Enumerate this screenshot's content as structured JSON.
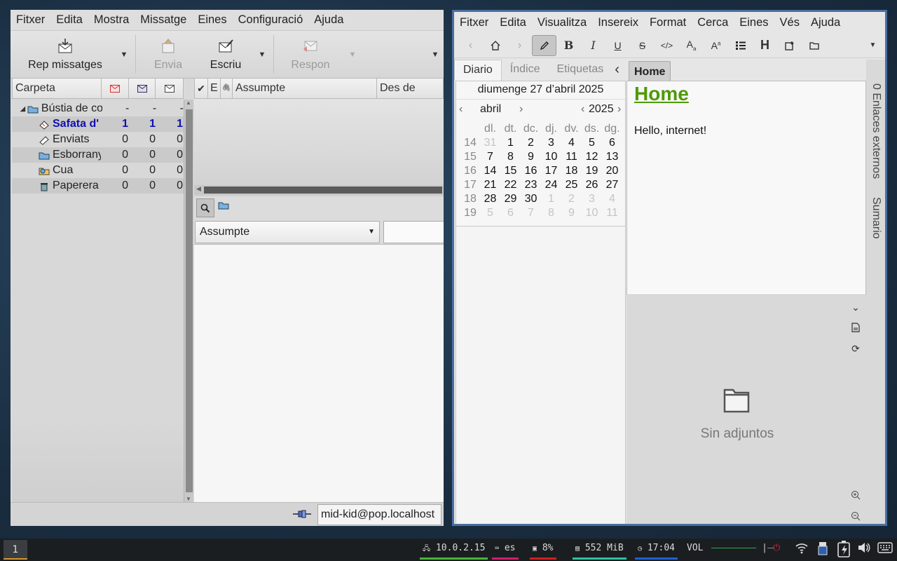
{
  "mail": {
    "menu": [
      "Fitxer",
      "Edita",
      "Mostra",
      "Missatge",
      "Eines",
      "Configuració",
      "Ajuda"
    ],
    "toolbar": {
      "receive": "Rep missatges",
      "send": "Envia",
      "compose": "Escriu",
      "reply": "Respon"
    },
    "folder_headers": {
      "folder": "Carpeta"
    },
    "folders": [
      {
        "name": "Bústia de co",
        "c1": "-",
        "c2": "-",
        "c3": "-"
      },
      {
        "name": "Safata d'",
        "c1": "1",
        "c2": "1",
        "c3": "1"
      },
      {
        "name": "Enviats",
        "c1": "0",
        "c2": "0",
        "c3": "0"
      },
      {
        "name": "Esborrany",
        "c1": "0",
        "c2": "0",
        "c3": "0"
      },
      {
        "name": "Cua",
        "c1": "0",
        "c2": "0",
        "c3": "0"
      },
      {
        "name": "Paperera",
        "c1": "0",
        "c2": "0",
        "c3": "0"
      }
    ],
    "list_headers": {
      "check": "✔",
      "e": "E",
      "attach": "🖇",
      "subject": "Assumpte",
      "from": "Des de"
    },
    "search": {
      "field": "Assumpte"
    },
    "status": {
      "account": "mid-kid@pop.localhost"
    }
  },
  "zim": {
    "menu": [
      "Fitxer",
      "Edita",
      "Visualitza",
      "Insereix",
      "Format",
      "Cerca",
      "Eines",
      "Vés",
      "Ajuda"
    ],
    "tabs": [
      "Diario",
      "Índice",
      "Etiquetas"
    ],
    "calendar": {
      "heading": "diumenge 27 d’abril 2025",
      "month": "abril",
      "year": "2025",
      "weekdays": [
        "dl.",
        "dt.",
        "dc.",
        "dj.",
        "dv.",
        "ds.",
        "dg."
      ],
      "weeks": [
        {
          "wk": "14",
          "days": [
            "31",
            "1",
            "2",
            "3",
            "4",
            "5",
            "6"
          ]
        },
        {
          "wk": "15",
          "days": [
            "7",
            "8",
            "9",
            "10",
            "11",
            "12",
            "13"
          ]
        },
        {
          "wk": "16",
          "days": [
            "14",
            "15",
            "16",
            "17",
            "18",
            "19",
            "20"
          ]
        },
        {
          "wk": "17",
          "days": [
            "21",
            "22",
            "23",
            "24",
            "25",
            "26",
            "27"
          ]
        },
        {
          "wk": "18",
          "days": [
            "28",
            "29",
            "30",
            "1",
            "2",
            "3",
            "4"
          ]
        },
        {
          "wk": "19",
          "days": [
            "5",
            "6",
            "7",
            "8",
            "9",
            "10",
            "11"
          ]
        }
      ]
    },
    "breadcrumb": "Home",
    "page": {
      "title": "Home",
      "body": "Hello, internet!",
      "title_color": "#4e9a06"
    },
    "attachments": {
      "empty": "Sin adjuntos"
    },
    "sidebar_tabs": [
      "0 Enlaces externos",
      "Sumario"
    ]
  },
  "taskbar": {
    "workspace": "1",
    "ip": "10.0.2.15",
    "kb": "es",
    "cpu": "8%",
    "mem": "552 MiB",
    "clock": "17:04",
    "vol": "VOL"
  }
}
